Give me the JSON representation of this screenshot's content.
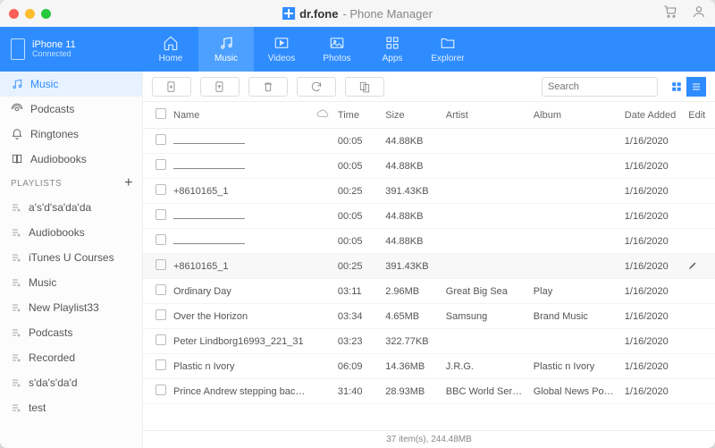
{
  "title": {
    "brand": "dr.fone",
    "sub": "- Phone Manager"
  },
  "device": {
    "name": "iPhone 11",
    "status": "Connected"
  },
  "tabs": {
    "home": "Home",
    "music": "Music",
    "videos": "Videos",
    "photos": "Photos",
    "apps": "Apps",
    "explorer": "Explorer"
  },
  "sidebar": {
    "music": "Music",
    "podcasts": "Podcasts",
    "ringtones": "Ringtones",
    "audiobooks": "Audiobooks",
    "playlists_header": "PLAYLISTS",
    "pl": [
      "a's'd'sa'da'da",
      "Audiobooks",
      "iTunes U Courses",
      "Music",
      "New Playlist33",
      "Podcasts",
      "Recorded",
      "s'da's'da'd",
      "test"
    ]
  },
  "search": {
    "placeholder": "Search"
  },
  "columns": {
    "name": "Name",
    "time": "Time",
    "size": "Size",
    "artist": "Artist",
    "album": "Album",
    "date": "Date Added",
    "edit": "Edit"
  },
  "rows": [
    {
      "name": "___",
      "time": "00:05",
      "size": "44.88KB",
      "artist": "",
      "album": "",
      "date": "1/16/2020",
      "edit": false
    },
    {
      "name": "___",
      "time": "00:05",
      "size": "44.88KB",
      "artist": "",
      "album": "",
      "date": "1/16/2020",
      "edit": false
    },
    {
      "name": "+8610165_1",
      "time": "00:25",
      "size": "391.43KB",
      "artist": "",
      "album": "",
      "date": "1/16/2020",
      "edit": false
    },
    {
      "name": "___",
      "time": "00:05",
      "size": "44.88KB",
      "artist": "",
      "album": "",
      "date": "1/16/2020",
      "edit": false
    },
    {
      "name": "___",
      "time": "00:05",
      "size": "44.88KB",
      "artist": "",
      "album": "",
      "date": "1/16/2020",
      "edit": false
    },
    {
      "name": "+8610165_1",
      "time": "00:25",
      "size": "391.43KB",
      "artist": "",
      "album": "",
      "date": "1/16/2020",
      "edit": true
    },
    {
      "name": "Ordinary Day",
      "time": "03:11",
      "size": "2.96MB",
      "artist": "Great Big Sea",
      "album": "Play",
      "date": "1/16/2020",
      "edit": false
    },
    {
      "name": "Over the Horizon",
      "time": "03:34",
      "size": "4.65MB",
      "artist": "Samsung",
      "album": "Brand Music",
      "date": "1/16/2020",
      "edit": false
    },
    {
      "name": "Peter Lindborg16993_221_31",
      "time": "03:23",
      "size": "322.77KB",
      "artist": "",
      "album": "",
      "date": "1/16/2020",
      "edit": false
    },
    {
      "name": "Plastic n Ivory",
      "time": "06:09",
      "size": "14.36MB",
      "artist": "J.R.G.",
      "album": "Plastic n Ivory",
      "date": "1/16/2020",
      "edit": false
    },
    {
      "name": "Prince Andrew stepping back fro...",
      "time": "31:40",
      "size": "28.93MB",
      "artist": "BBC World Service",
      "album": "Global News Podc...",
      "date": "1/16/2020",
      "edit": false
    }
  ],
  "status": "37 item(s), 244.48MB"
}
